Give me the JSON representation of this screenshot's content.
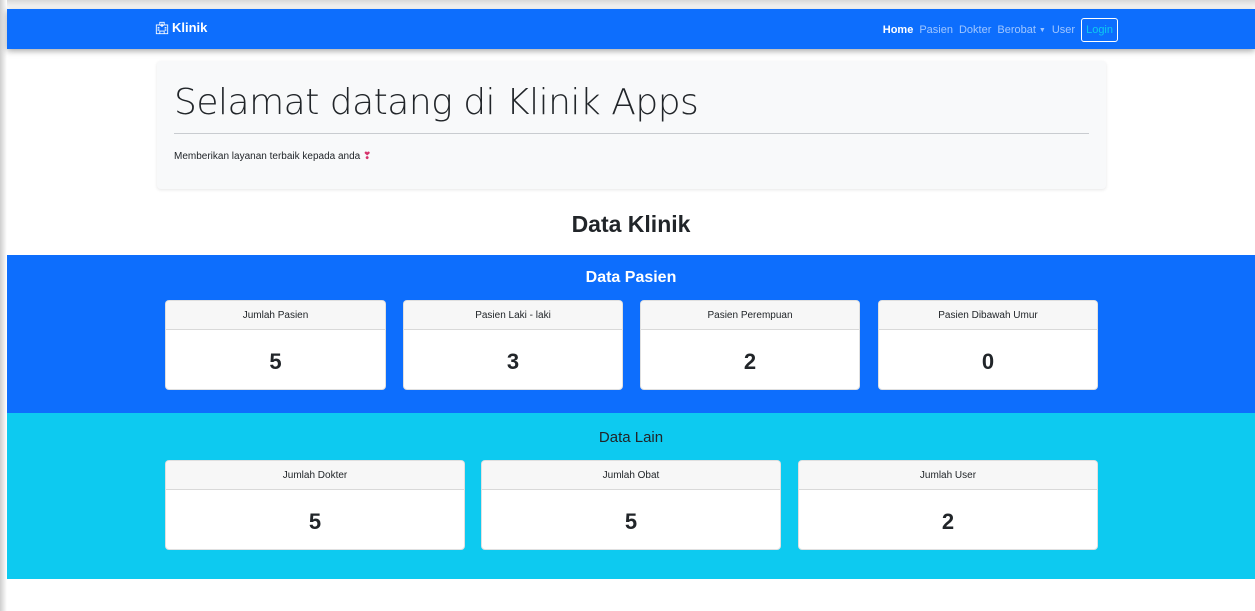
{
  "navbar": {
    "brand": "Klinik",
    "brand_icon": "hospital-icon",
    "links": [
      {
        "label": "Home",
        "active": true
      },
      {
        "label": "Pasien",
        "active": false
      },
      {
        "label": "Dokter",
        "active": false
      },
      {
        "label": "Berobat",
        "active": false,
        "dropdown": true
      },
      {
        "label": "User",
        "active": false
      }
    ],
    "login_label": "Login"
  },
  "jumbotron": {
    "title": "Selamat datang di Klinik Apps",
    "subtitle": "Memberikan layanan terbaik kepada anda",
    "subtitle_icon": "heart-icon"
  },
  "section_title": "Data Klinik",
  "pasien": {
    "title": "Data Pasien",
    "cards": [
      {
        "label": "Jumlah Pasien",
        "value": "5"
      },
      {
        "label": "Pasien Laki - laki",
        "value": "3"
      },
      {
        "label": "Pasien Perempuan",
        "value": "2"
      },
      {
        "label": "Pasien Dibawah Umur",
        "value": "0"
      }
    ]
  },
  "lain": {
    "title": "Data Lain",
    "cards": [
      {
        "label": "Jumlah Dokter",
        "value": "5"
      },
      {
        "label": "Jumlah Obat",
        "value": "5"
      },
      {
        "label": "Jumlah User",
        "value": "2"
      }
    ]
  },
  "colors": {
    "primary": "#0d6efd",
    "info": "#0dcaf0",
    "light": "#f8f9fa"
  }
}
